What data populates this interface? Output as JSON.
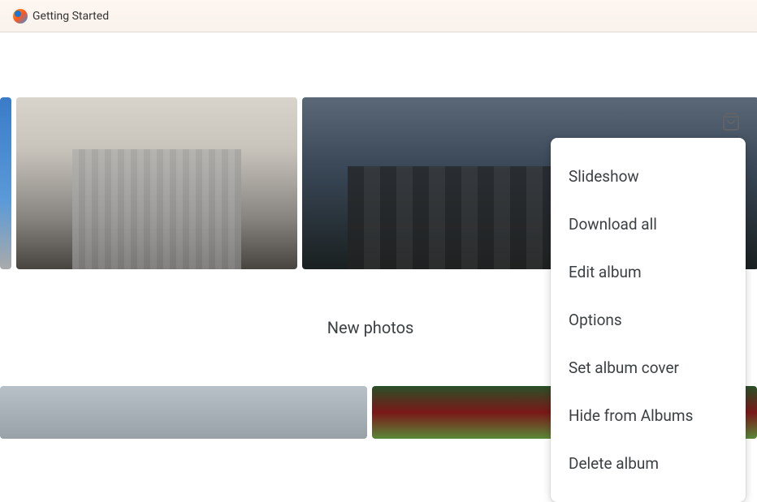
{
  "bookmark": {
    "label": "Getting Started"
  },
  "section": {
    "heading": "New photos"
  },
  "menu": {
    "items": [
      {
        "label": "Slideshow"
      },
      {
        "label": "Download all"
      },
      {
        "label": "Edit album"
      },
      {
        "label": "Options"
      },
      {
        "label": "Set album cover"
      },
      {
        "label": "Hide from Albums"
      },
      {
        "label": "Delete album"
      }
    ]
  }
}
